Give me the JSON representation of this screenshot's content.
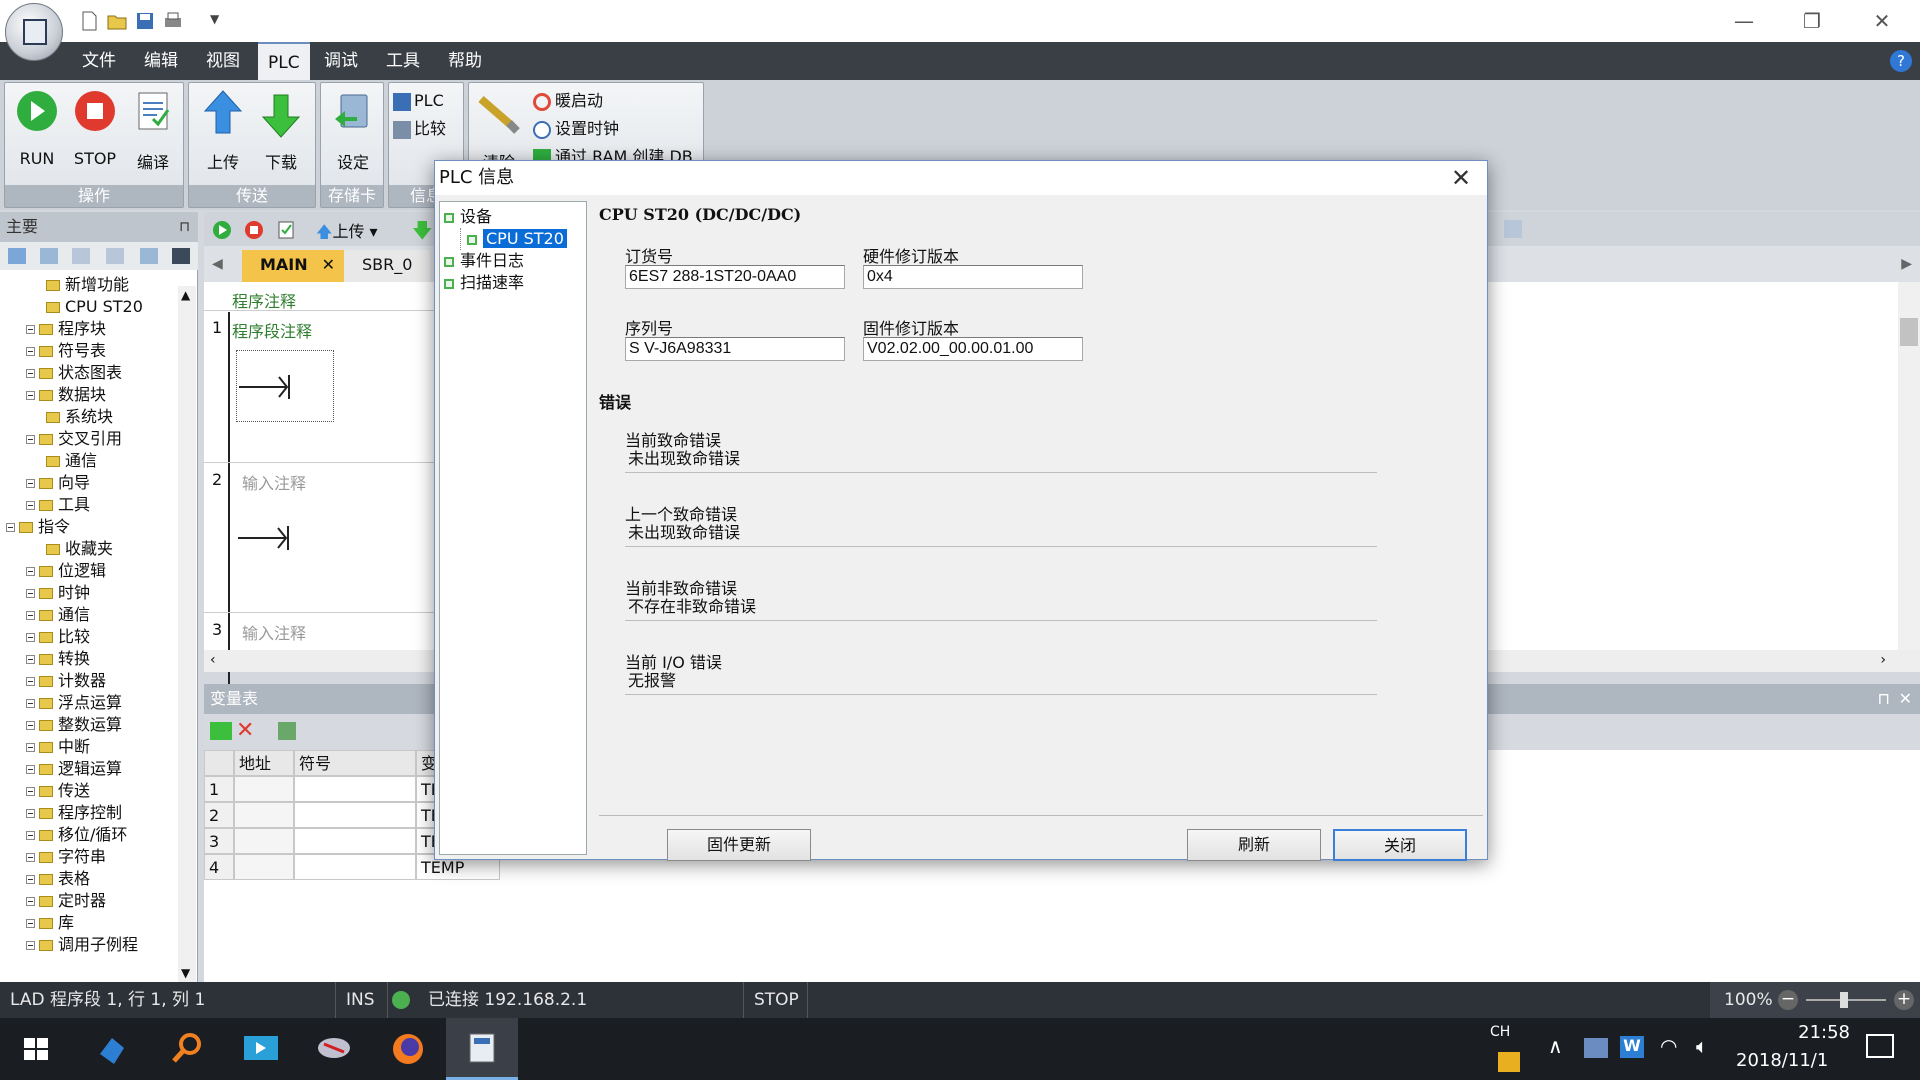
{
  "titlebar": {
    "menu_items": [
      "文件",
      "编辑",
      "视图",
      "PLC",
      "调试",
      "工具",
      "帮助"
    ],
    "active_menu": "PLC",
    "minimize": "—",
    "restore": "❐",
    "close": "✕",
    "help": "?"
  },
  "ribbon": {
    "groups": [
      {
        "title": "操作",
        "buttons": [
          "RUN",
          "STOP",
          "编译"
        ]
      },
      {
        "title": "传送",
        "buttons": [
          "上传",
          "下载"
        ]
      },
      {
        "title": "存储卡",
        "buttons": [
          "设定"
        ]
      },
      {
        "title": "信息",
        "buttons": [
          "PLC",
          "比较"
        ]
      },
      {
        "title": "",
        "buttons": [
          "清除",
          "暖启动",
          "设置时钟",
          "通过 RAM 创建 DB"
        ]
      }
    ]
  },
  "leftpane": {
    "title": "主要",
    "pin": "⊓",
    "tree": [
      {
        "label": "新增功能",
        "indent": 2,
        "expand": false
      },
      {
        "label": "CPU ST20",
        "indent": 2,
        "expand": false
      },
      {
        "label": "程序块",
        "indent": 1,
        "expand": true
      },
      {
        "label": "符号表",
        "indent": 1,
        "expand": true
      },
      {
        "label": "状态图表",
        "indent": 1,
        "expand": true
      },
      {
        "label": "数据块",
        "indent": 1,
        "expand": true
      },
      {
        "label": "系统块",
        "indent": 2,
        "expand": false
      },
      {
        "label": "交叉引用",
        "indent": 1,
        "expand": true
      },
      {
        "label": "通信",
        "indent": 2,
        "expand": false
      },
      {
        "label": "向导",
        "indent": 1,
        "expand": true
      },
      {
        "label": "工具",
        "indent": 1,
        "expand": true
      },
      {
        "label": "指令",
        "indent": 0,
        "expand": true
      },
      {
        "label": "收藏夹",
        "indent": 2,
        "expand": false
      },
      {
        "label": "位逻辑",
        "indent": 1,
        "expand": true
      },
      {
        "label": "时钟",
        "indent": 1,
        "expand": true
      },
      {
        "label": "通信",
        "indent": 1,
        "expand": true
      },
      {
        "label": "比较",
        "indent": 1,
        "expand": true
      },
      {
        "label": "转换",
        "indent": 1,
        "expand": true
      },
      {
        "label": "计数器",
        "indent": 1,
        "expand": true
      },
      {
        "label": "浮点运算",
        "indent": 1,
        "expand": true
      },
      {
        "label": "整数运算",
        "indent": 1,
        "expand": true
      },
      {
        "label": "中断",
        "indent": 1,
        "expand": true
      },
      {
        "label": "逻辑运算",
        "indent": 1,
        "expand": true
      },
      {
        "label": "传送",
        "indent": 1,
        "expand": true
      },
      {
        "label": "程序控制",
        "indent": 1,
        "expand": true
      },
      {
        "label": "移位/循环",
        "indent": 1,
        "expand": true
      },
      {
        "label": "字符串",
        "indent": 1,
        "expand": true
      },
      {
        "label": "表格",
        "indent": 1,
        "expand": true
      },
      {
        "label": "定时器",
        "indent": 1,
        "expand": true
      },
      {
        "label": "库",
        "indent": 1,
        "expand": true
      },
      {
        "label": "调用子例程",
        "indent": 1,
        "expand": true
      }
    ]
  },
  "editor": {
    "upload": "上传",
    "tabs": [
      "MAIN",
      "SBR_0"
    ],
    "program_comment": "程序注释",
    "networks": [
      {
        "num": "1",
        "comment": "程序段注释"
      },
      {
        "num": "2",
        "comment": "输入注释"
      },
      {
        "num": "3",
        "comment": "输入注释"
      }
    ]
  },
  "vartable": {
    "title": "变量表",
    "headers": [
      "地址",
      "符号",
      "变"
    ],
    "rows": [
      [
        "1",
        "",
        "TE"
      ],
      [
        "2",
        "",
        "TE"
      ],
      [
        "3",
        "",
        "TE"
      ],
      [
        "4",
        "",
        "TEMP"
      ]
    ]
  },
  "status": {
    "mode": "LAD 程序段 1, 行 1, 列 1",
    "ins": "INS",
    "connection": "已连接 192.168.2.1",
    "run_state": "STOP",
    "zoom": "100%",
    "connection_color": "#4caf50"
  },
  "taskbar": {
    "lang": "CH",
    "time": "21:58",
    "date": "2018/11/1"
  },
  "dialog": {
    "title": "PLC 信息",
    "close": "✕",
    "tree": [
      {
        "label": "设备",
        "indent": 0
      },
      {
        "label": "CPU ST20",
        "indent": 1,
        "selected": true
      },
      {
        "label": "事件日志",
        "indent": 0
      },
      {
        "label": "扫描速率",
        "indent": 0
      }
    ],
    "device_title": "CPU ST20 (DC/DC/DC)",
    "order_label": "订货号",
    "order_value": "6ES7 288-1ST20-0AA0",
    "hw_label": "硬件修订版本",
    "hw_value": "0x4",
    "serial_label": "序列号",
    "serial_value": "S V-J6A98331",
    "fw_label": "固件修订版本",
    "fw_value": "V02.02.00_00.00.01.00",
    "errors_title": "错误",
    "cur_fatal_label": "当前致命错误",
    "cur_fatal_value": "未出现致命错误",
    "prev_fatal_label": "上一个致命错误",
    "prev_fatal_value": "未出现致命错误",
    "cur_nonfatal_label": "当前非致命错误",
    "cur_nonfatal_value": "不存在非致命错误",
    "io_label": "当前 I/O 错误",
    "io_value": "无报警",
    "btn_firmware": "固件更新",
    "btn_refresh": "刷新",
    "btn_close": "关闭"
  }
}
